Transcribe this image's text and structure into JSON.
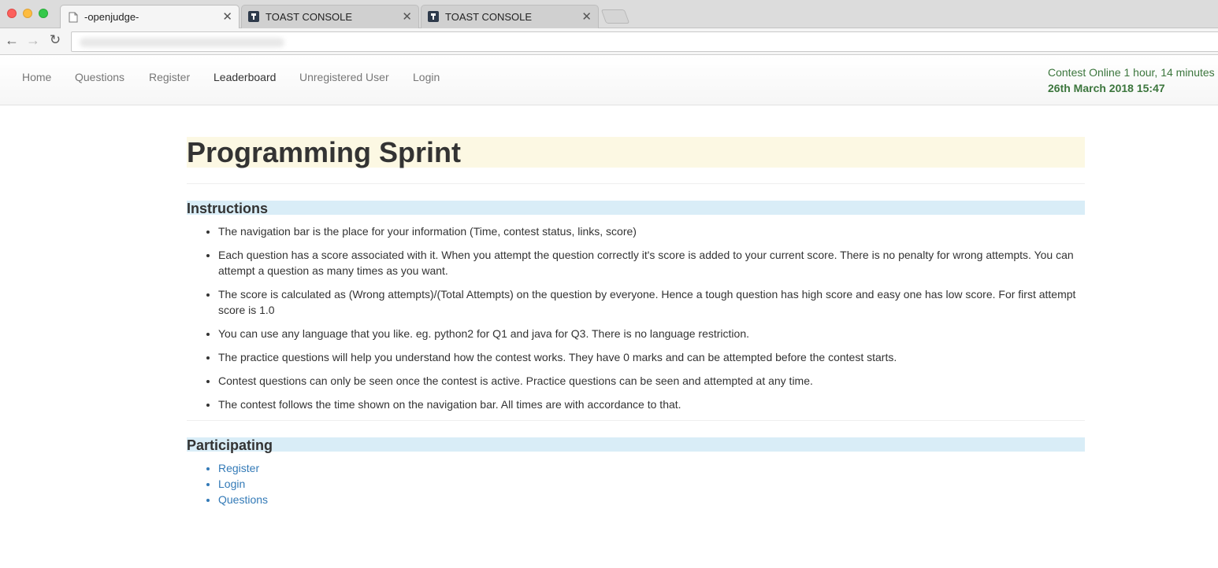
{
  "browser": {
    "tabs": [
      {
        "title": "-openjudge-",
        "active": true,
        "icon": "page-icon"
      },
      {
        "title": "TOAST CONSOLE",
        "active": false,
        "icon": "toast-icon"
      },
      {
        "title": "TOAST CONSOLE",
        "active": false,
        "icon": "toast-icon"
      }
    ],
    "close_glyph": "✕",
    "back_glyph": "←",
    "forward_glyph": "→",
    "reload_glyph": "↻"
  },
  "navbar": {
    "links": [
      "Home",
      "Questions",
      "Register",
      "Leaderboard",
      "Unregistered User",
      "Login"
    ],
    "active_link": "Leaderboard",
    "status_text": "Contest Online 1 hour, 14 minutes",
    "date_text": "26th March 2018 15:47",
    "status_color": "#3c763d"
  },
  "main": {
    "title": "Programming Sprint",
    "instructions_heading": "Instructions",
    "instructions": [
      "The navigation bar is the place for your information (Time, contest status, links, score)",
      "Each question has a score associated with it. When you attempt the question correctly it's score is added to your current score. There is no penalty for wrong attempts. You can attempt a question as many times as you want.",
      "The score is calculated as (Wrong attempts)/(Total Attempts) on the question by everyone. Hence a tough question has high score and easy one has low score. For first attempt score is 1.0",
      "You can use any language that you like. eg. python2 for Q1 and java for Q3. There is no language restriction.",
      "The practice questions will help you understand how the contest works. They have 0 marks and can be attempted before the contest starts.",
      "Contest questions can only be seen once the contest is active. Practice questions can be seen and attempted at any time.",
      "The contest follows the time shown on the navigation bar. All times are with accordance to that."
    ],
    "participating_heading": "Participating",
    "participating_links": [
      "Register",
      "Login",
      "Questions"
    ]
  },
  "colors": {
    "title_bg": "#fcf8e3",
    "heading_bg": "#d9edf7",
    "link": "#337ab7"
  }
}
